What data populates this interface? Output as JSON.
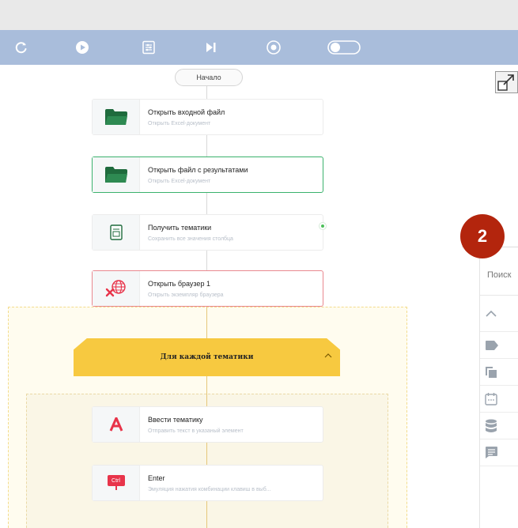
{
  "start_label": "Начало",
  "nodes": [
    {
      "title": "Открыть входной файл",
      "subtitle": "Открыть Excel-документ",
      "icon": "folder-icon"
    },
    {
      "title": "Открыть файл с результатами",
      "subtitle": "Открыть Excel-документ",
      "icon": "folder-icon"
    },
    {
      "title": "Получить тематики",
      "subtitle": "Сохранить все значения столбца",
      "icon": "excel-column-icon"
    },
    {
      "title": "Открыть браузер 1",
      "subtitle": "Открыть экземпляр браузера",
      "icon": "browser-globe-icon"
    }
  ],
  "loop": {
    "title": "Для каждой тематики"
  },
  "inner_nodes": [
    {
      "title": "Ввести тематику",
      "subtitle": "Отправить текст в указаный элемент",
      "icon": "text-input-icon"
    },
    {
      "title": "Enter",
      "subtitle": "Эмуляция нажатия комбинации клавиш в выб...",
      "icon": "ctrl-key-icon",
      "icon_text": "Ctrl"
    }
  ],
  "badge_number": "2",
  "panel": {
    "search_text": "Поиск"
  },
  "colors": {
    "toolbar": "#a9bddb",
    "green": "#1f6b3d",
    "selected_green": "#3bb26d",
    "selected_red": "#e9888f",
    "loop_yellow": "#f7c940",
    "badge": "#b3250d",
    "accent_red": "#e8344a"
  }
}
